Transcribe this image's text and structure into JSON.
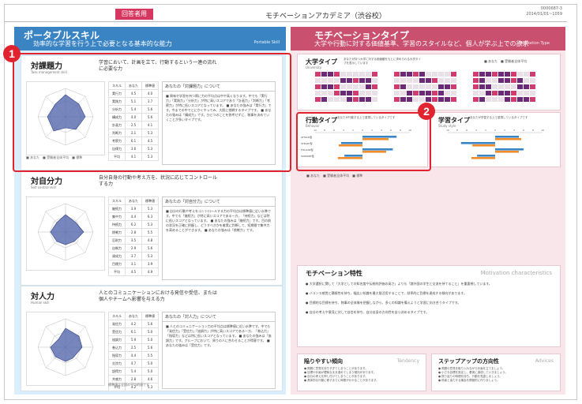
{
  "header": {
    "tag": "回答者用",
    "title": "モチベーションアカデミア（渋谷校）",
    "code_line1": "0000687-3",
    "code_line2": "2014/01/01~1059"
  },
  "left": {
    "title": "ポータブルスキル",
    "subtitle": "効率的な学習を行う上で必要となる基本的な能力",
    "en": "Portable Skill"
  },
  "right": {
    "title": "モチベーションタイプ",
    "subtitle": "大学や行動に対する価値基準、学習のスタイルなど、個人が学ぶ上での欲求",
    "en": "Motivation Type"
  },
  "sections": [
    {
      "title": "対課題力",
      "sub": "Task management skill",
      "desc": "学習において、計画を立て、行動するという一連の流れに必要な力",
      "comment_title": "あなたの「対課題力」について",
      "comment_body": "■ 興味や学習を持つ際に力の平均点は中や高くなります。中でも「実行力」「実践力」「分析力」が特に高いスコアであり「計画力」「判断力」「考察力」が特に低いスコアとなっています。\n■ あなたの強みは「実行力」です。今までの中でとにかくやってみ、大胆に挑戦するタイプです。\n■ あなたの強みは「構成力」です。ひとつのことを熟考せずに、物事を決めていくことが多いタイプです。",
      "rows": [
        [
          "実行力",
          "4.5",
          "4.0"
        ],
        [
          "実践力",
          "5.1",
          "3.7"
        ],
        [
          "分析力",
          "5.4",
          "5.6"
        ],
        [
          "構成力",
          "4.0",
          "5.6"
        ],
        [
          "計画力",
          "2.5",
          "4.1"
        ],
        [
          "判断力",
          "2.1",
          "5.3"
        ],
        [
          "考察力",
          "6.1",
          "4.5"
        ],
        [
          "自律力",
          "3.6",
          "5.3"
        ],
        [
          "平均",
          "4.1",
          "5.3"
        ]
      ]
    },
    {
      "title": "対自分力",
      "sub": "Self control skill",
      "desc": "自分自身の行動や考え方を、状況に応じてコントロールする力",
      "comment_title": "あなたの「対自分力」について",
      "comment_body": "■ 自分の行動や考えをコントロールする力の平均点は標準値に近い水準です。中でも「継続力」が特に高いスコアである一方、「持続力」などは特に低いスコアとなっています。\n■ あなたの強みは「継続力」です。目の前の状況を正確に把握し、どうすべきかを着実に判断して、短期間で集中力を高めることができます。\n■ あなたの強みは「挑戦力」です。",
      "rows": [
        [
          "継続力",
          "3.9",
          "5.3"
        ],
        [
          "集中力",
          "4.4",
          "6.3"
        ],
        [
          "持続力",
          "6.2",
          "5.3"
        ],
        [
          "挑戦力",
          "2.8",
          "5.5"
        ],
        [
          "忍耐力",
          "3.5",
          "4.8"
        ],
        [
          "自制力",
          "2.9",
          "5.6"
        ],
        [
          "達成力",
          "3.7",
          "5.3"
        ],
        [
          "目標力",
          "3.1",
          "3.9"
        ],
        [
          "平均",
          "4.5",
          "4.9"
        ]
      ]
    },
    {
      "title": "対人力",
      "sub": "Human skill",
      "desc": "人とのコミュニケーションにおける発信や受信、または個人やチームへ影響を与える力",
      "comment_title": "あなたの「対人力」について",
      "comment_body": "■ 人とのコミュニケーション力の平均点は標準値に近い水準です。中でも「発信力」「受信力」「協調力」が特に高いスコアである一方、「巻込力」「指導力」などは特に低いスコアとなっています。\n■ あなたの強みは「協調力」です。グループにおいて、周りの人に合わせることが得意です。\n■ あなたの強みは「受信力」です。",
      "rows": [
        [
          "発信力",
          "4.2",
          "5.6"
        ],
        [
          "受信力",
          "6.1",
          "5.0"
        ],
        [
          "協調力",
          "5.9",
          "5.0"
        ],
        [
          "巻込力",
          "2.5",
          "5.6"
        ],
        [
          "指導力",
          "4.4",
          "5.5"
        ],
        [
          "交渉力",
          "4.7",
          "5.0"
        ],
        [
          "説得力",
          "5.4",
          "5.0"
        ],
        [
          "共感力",
          "2.8",
          "4.6"
        ],
        [
          "平均",
          "4.2",
          "5.3"
        ]
      ]
    }
  ],
  "table_head": [
    "スキル",
    "あなた",
    "標準値"
  ],
  "legend": [
    "あなた",
    "受験者全体平均",
    "標準"
  ],
  "note": "標準値は全国の平均的値です",
  "univ": {
    "title": "大学タイプ",
    "sub": "University",
    "desc": "あなたが持つ大学に対する価値観をもとに求められる大学タイプを表示しています",
    "legend": [
      "あなた",
      "受験者全体平均"
    ]
  },
  "action": {
    "title": "行動タイプ",
    "sub": "Behavior",
    "desc": "あなたが行動する上で重視しているタイプです",
    "rows": [
      "ATTACK型",
      "STEADY型",
      "FOLLOW型",
      "SUPPORT型"
    ],
    "values": [
      0.72,
      0.45,
      0.64,
      0.38
    ],
    "avg": [
      0.55,
      0.5,
      0.5,
      0.52
    ],
    "ticks": [
      "10",
      "8",
      "6",
      "4",
      "2",
      "0",
      "2",
      "4",
      "6",
      "8",
      "10"
    ],
    "legend": [
      "あなた",
      "受験者全体平均",
      "標準"
    ]
  },
  "study": {
    "title": "学習タイプ",
    "sub": "Study style",
    "desc": "あなたが学習する上で重視しているタイプです",
    "values": [
      0.5,
      0.72,
      0.6,
      0.38
    ],
    "avg": [
      0.55,
      0.48,
      0.5,
      0.5
    ]
  },
  "motivation": {
    "title": "モチベーション特性",
    "en": "Motivation characteristics",
    "items": [
      "大学選択に関して「大学としての知名度や伝統的評価の高さ」よりも「諸外国の学生と交流を持てること」を重要視しています。",
      "バランス感覚と積極性を持ち、幅広い知識を最大限活用することで、効率的に目標を達成する傾向があります。",
      "目標的な目標を持ち、物事の全体像を把握しながら、多くの知識を備えようと学習に向き合うタイプです。",
      "自分の考えや意見に対して自信を持ち、自分自身の方向性を自ら決めるタイプです。"
    ]
  },
  "tendency": {
    "title": "陥りやすい傾向",
    "en": "Tendency",
    "items": [
      "周囲に意見を持ちすぎてしまうことがあります。",
      "目標や計画が曖昧なまま進めてしまう傾向があります。",
      "自分の考えを押し付けてしまうことがあります。",
      "具体的な行動に移すまでに時間がかかることがあります。"
    ]
  },
  "advice": {
    "title": "ステップアップの方向性",
    "en": "Advices",
    "items": [
      "周囲の意見を取り入れながら計画を立てましょう。",
      "小さな目標を設定し、着実に達成していきましょう。",
      "振り返りの時間を持ち、行動を見直しましょう。",
      "他者と協力する機会を積極的に作りましょう。"
    ]
  },
  "badges": [
    "1",
    "2"
  ],
  "colors": {
    "blue": "#3a84c4",
    "pink": "#c9506f",
    "red": "#e0232f",
    "purple": "#6b2a78",
    "orange": "#f08c2a"
  }
}
